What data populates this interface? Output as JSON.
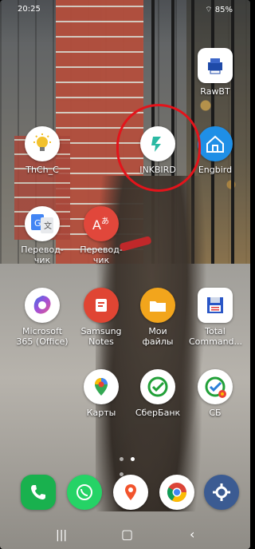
{
  "status_bar": {
    "time": "20:25",
    "battery": "85%"
  },
  "apps": [
    {
      "label": "RawBT"
    },
    {
      "label": "ThCh_C"
    },
    {
      "label": "INKBIRD"
    },
    {
      "label": "Engbird"
    },
    {
      "label": "Перевод-\nчик"
    },
    {
      "label": "Перевод-\nчик"
    },
    {
      "label": "Microsoft\n365 (Office)"
    },
    {
      "label": "Samsung\nNotes"
    },
    {
      "label": "Мои\nфайлы"
    },
    {
      "label": "Total\nCommand..."
    },
    {
      "label": "Карты"
    },
    {
      "label": "СберБанк"
    },
    {
      "label": "СБ"
    }
  ],
  "dock_apps": [
    "Phone",
    "WhatsApp",
    "Maps",
    "Chrome",
    "Settings"
  ],
  "nav_icons": [
    "recent-apps-icon",
    "home-icon",
    "back-icon"
  ],
  "colors": {
    "highlight": "#e3141b"
  }
}
